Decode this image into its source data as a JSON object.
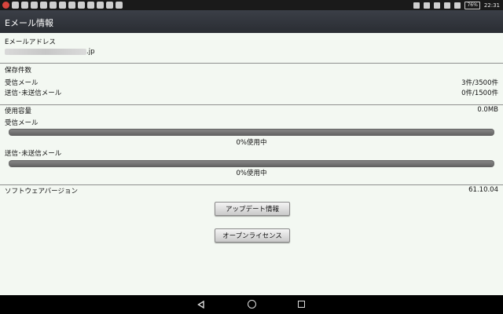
{
  "status_bar": {
    "time": "22:31",
    "battery": "76%",
    "left_icons": [
      "app-notification-icon",
      "mail-icon",
      "transfer-icon",
      "doc-icon",
      "globe-icon",
      "gmail-icon",
      "calendar-icon",
      "cart-icon",
      "clipboard-icon",
      "chat-icon",
      "chat2-icon",
      "message-icon",
      "play-icon"
    ],
    "right_icons": [
      "bluetooth-icon",
      "nfc-icon",
      "silent-icon",
      "wifi-icon",
      "signal-icon",
      "battery-icon"
    ]
  },
  "title_bar": {
    "title": "Eメール情報"
  },
  "email": {
    "label": "Eメールアドレス",
    "value_visible": ".jp"
  },
  "storage_count": {
    "header": "保存件数",
    "received_label": "受信メール",
    "received_value": "3件/3500件",
    "sent_label": "送信･未送信メール",
    "sent_value": "0件/1500件"
  },
  "usage": {
    "header": "使用容量",
    "total_value": "0.0MB",
    "received_label": "受信メール",
    "received_progress_text": "0%使用中",
    "received_progress": 0,
    "sent_label": "送信･未送信メール",
    "sent_progress_text": "0%使用中",
    "sent_progress": 0
  },
  "software": {
    "label": "ソフトウェアバージョン",
    "version": "61.10.04"
  },
  "buttons": {
    "update_info": "アップデート情報",
    "open_license": "オープンライセンス"
  },
  "colors": {
    "background": "#f3f8f2",
    "title_bar": "#2e3138",
    "progress_track": "#6e6e6e"
  }
}
